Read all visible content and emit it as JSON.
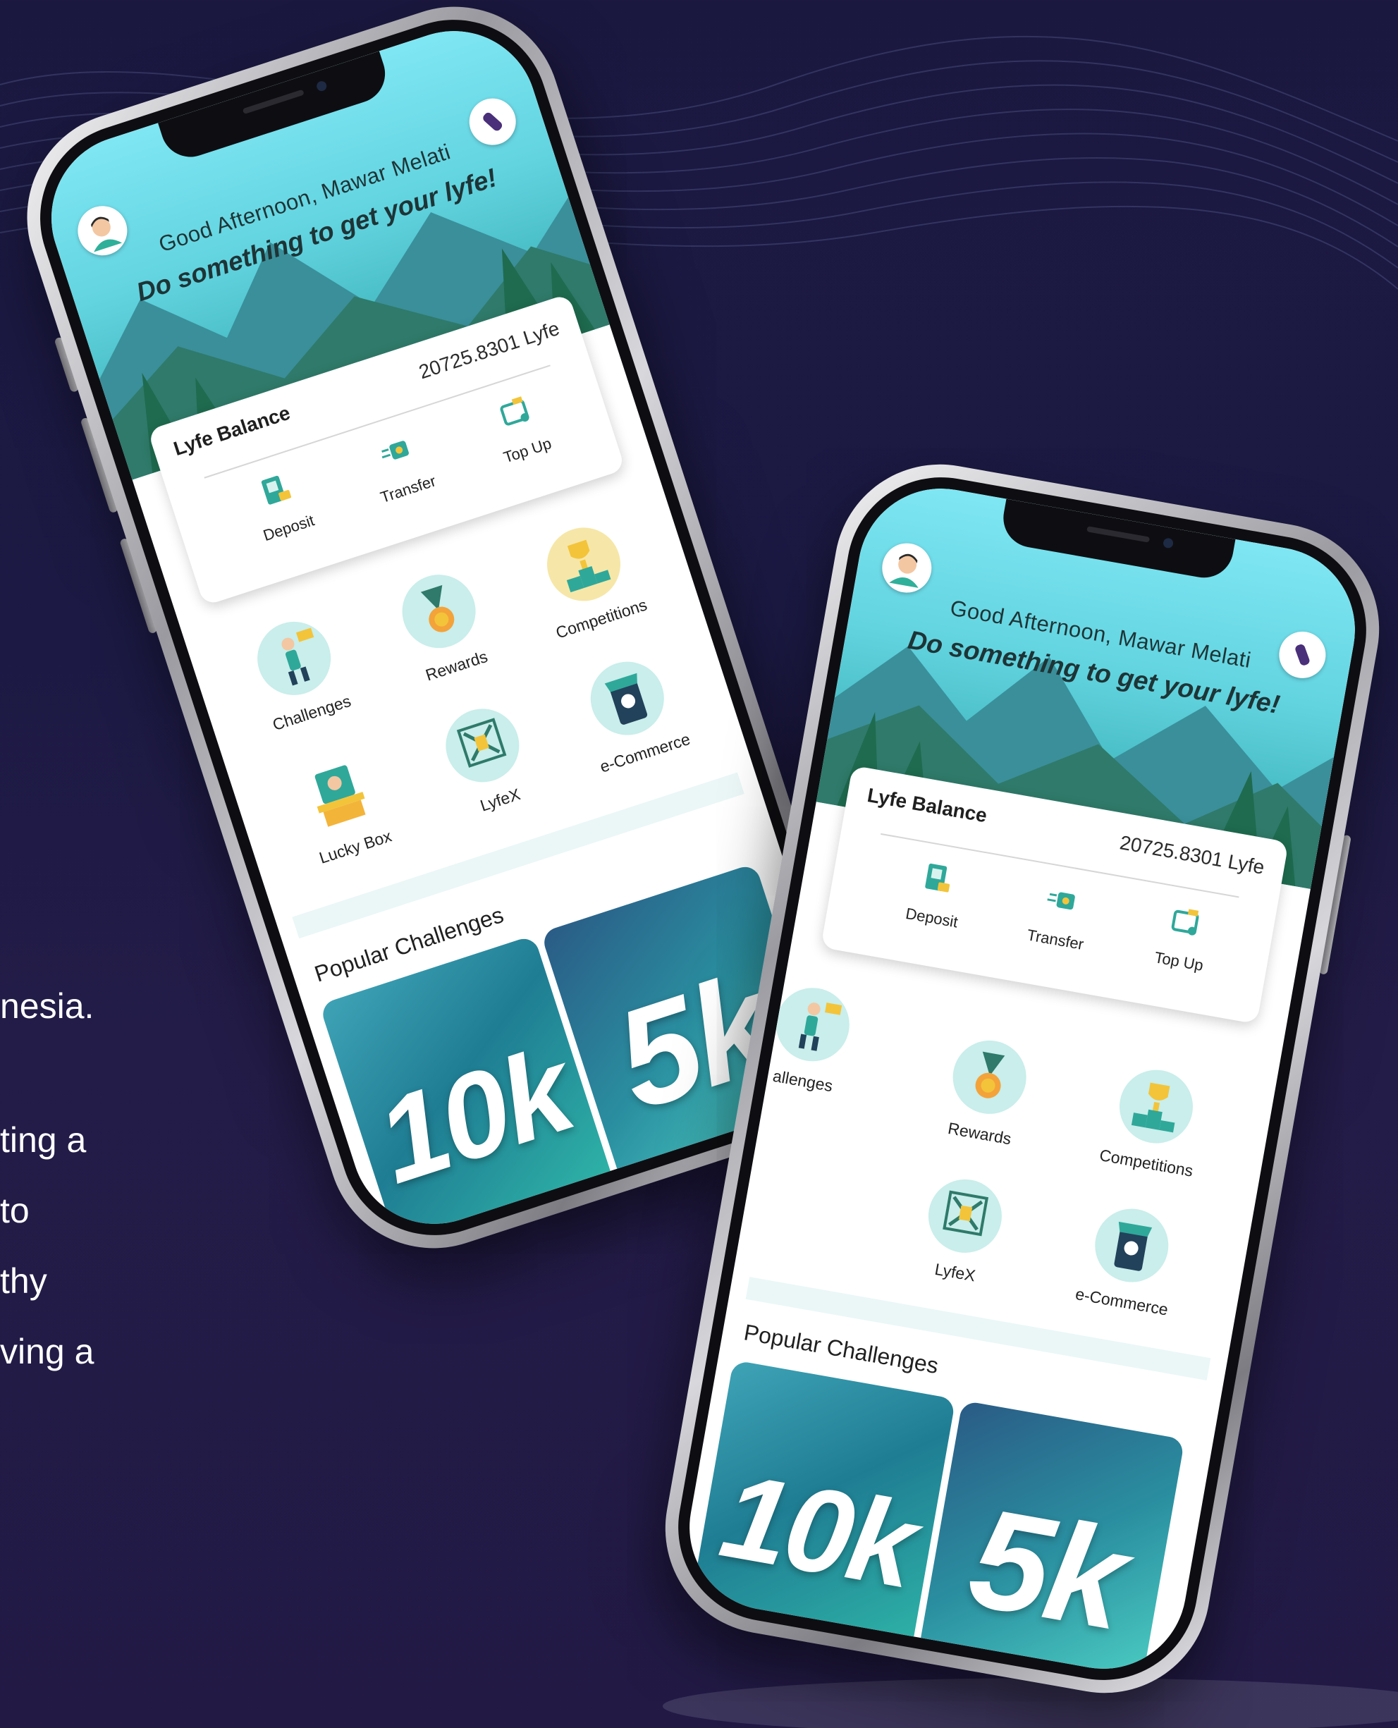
{
  "side_text": [
    "nesia.",
    "ting a",
    "to",
    "thy",
    "ving a"
  ],
  "phones": [
    {
      "greeting": "Good Afternoon, Mawar Melati",
      "tagline": "Do something to get your lyfe!",
      "balance": {
        "label": "Lyfe Balance",
        "value": "20725.8301 Lyfe"
      },
      "actions": [
        {
          "label": "Deposit",
          "icon": "deposit-icon"
        },
        {
          "label": "Transfer",
          "icon": "transfer-icon"
        },
        {
          "label": "Top Up",
          "icon": "top-up-icon"
        }
      ],
      "menu": [
        {
          "label": "Challenges",
          "icon": "challenges-icon"
        },
        {
          "label": "Rewards",
          "icon": "rewards-icon"
        },
        {
          "label": "Competitions",
          "icon": "competitions-icon"
        },
        {
          "label": "Lucky Box",
          "icon": "lucky-box-icon"
        },
        {
          "label": "LyfeX",
          "icon": "lyfex-icon"
        },
        {
          "label": "e-Commerce",
          "icon": "e-commerce-icon"
        }
      ],
      "popular_title": "Popular Challenges",
      "challenges": [
        "10k",
        "5k"
      ]
    },
    {
      "greeting": "Good Afternoon, Mawar Melati",
      "tagline": "Do something to get your lyfe!",
      "balance": {
        "label": "Lyfe Balance",
        "value": "20725.8301 Lyfe"
      },
      "actions": [
        {
          "label": "Deposit",
          "icon": "deposit-icon"
        },
        {
          "label": "Transfer",
          "icon": "transfer-icon"
        },
        {
          "label": "Top Up",
          "icon": "top-up-icon"
        }
      ],
      "menu": [
        {
          "label": "allenges",
          "icon": "challenges-icon"
        },
        {
          "label": "Rewards",
          "icon": "rewards-icon"
        },
        {
          "label": "Competitions",
          "icon": "competitions-icon"
        },
        {
          "label": "LyfeX",
          "icon": "lyfex-icon"
        },
        {
          "label": "e-Commerce",
          "icon": "e-commerce-icon"
        }
      ],
      "popular_title": "Popular Challenges",
      "challenges": [
        "10k",
        "5k"
      ]
    }
  ],
  "colors": {
    "background": "#1c1a44",
    "hero_teal": "#62d4e0",
    "tile_teal": "#1f7d93",
    "menu_circle": "#c9eeeb"
  }
}
